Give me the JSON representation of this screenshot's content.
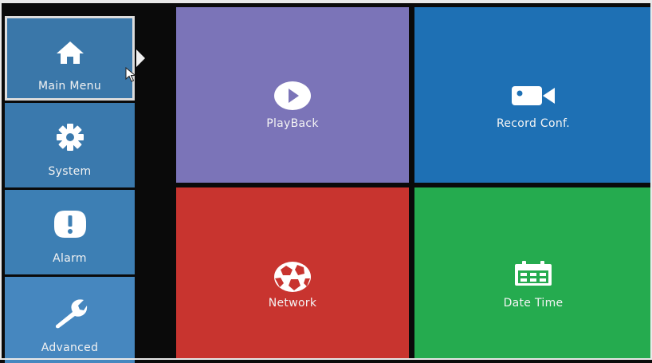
{
  "sidebar": {
    "items": [
      {
        "label": "Main Menu",
        "icon": "home-icon",
        "selected": true
      },
      {
        "label": "System",
        "icon": "gear-icon"
      },
      {
        "label": "Alarm",
        "icon": "alert-icon"
      },
      {
        "label": "Advanced",
        "icon": "wrench-icon"
      }
    ]
  },
  "tiles": [
    {
      "label": "PlayBack",
      "icon": "play-icon",
      "color": "#7b74b8"
    },
    {
      "label": "Record Conf.",
      "icon": "camera-icon",
      "color": "#1e70b4"
    },
    {
      "label": "Network",
      "icon": "network-ball-icon",
      "color": "#c8342f"
    },
    {
      "label": "Date Time",
      "icon": "calendar-icon",
      "color": "#25ab4f"
    }
  ],
  "colors": {
    "background": "#0a0a0a",
    "sidebar_selected": "#3a77a9",
    "sidebar": "#3a79ad",
    "sidebar_advanced": "#4687bf"
  }
}
